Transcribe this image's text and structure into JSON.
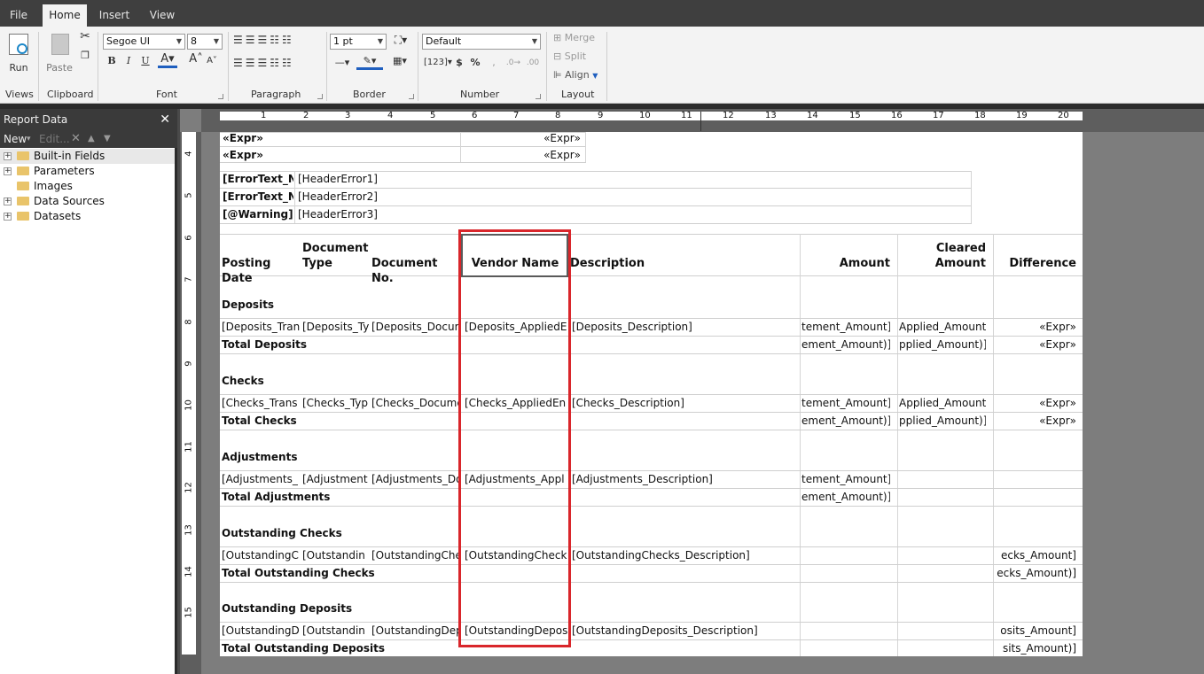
{
  "menu": {
    "tabs": [
      "File",
      "Home",
      "Insert",
      "View"
    ]
  },
  "ribbon": {
    "groups": [
      "Views",
      "Clipboard",
      "Font",
      "Paragraph",
      "Border",
      "Number",
      "Layout"
    ],
    "run_label": "Run",
    "paste_label": "Paste",
    "font_name": "Segoe UI",
    "font_size": "8",
    "border_width": "1 pt",
    "number_format": "Default",
    "merge_label": "Merge",
    "split_label": "Split",
    "align_label": "Align"
  },
  "report_data": {
    "title": "Report Data",
    "new_label": "New",
    "edit_label": "Edit...",
    "items": [
      "Built-in Fields",
      "Parameters",
      "Images",
      "Data Sources",
      "Datasets"
    ]
  },
  "ruler": {
    "top": [
      "1",
      "2",
      "3",
      "4",
      "5",
      "6",
      "7",
      "8",
      "9",
      "10",
      "11",
      "12",
      "13",
      "14",
      "15",
      "16",
      "17",
      "18",
      "19",
      "20"
    ],
    "left": [
      "4",
      "5",
      "6",
      "7",
      "8",
      "9",
      "10",
      "11",
      "12",
      "13",
      "14",
      "15"
    ]
  },
  "report": {
    "expr_rows": [
      {
        "left": "«Expr»",
        "right": "«Expr»"
      },
      {
        "left": "«Expr»",
        "right": "«Expr»"
      }
    ],
    "error_rows": [
      {
        "label": "[ErrorText_Nu",
        "value": "[HeaderError1]"
      },
      {
        "label": "[ErrorText_Nu",
        "value": "[HeaderError2]"
      },
      {
        "label": "[@Warning]",
        "value": "[HeaderError3]"
      }
    ],
    "headers": {
      "posting_date": "Posting Date",
      "document_type": "Document Type",
      "document_no": "Document No.",
      "vendor_name": "Vendor Name",
      "description": "Description",
      "amount": "Amount",
      "cleared_amount": "Cleared Amount",
      "difference": "Difference"
    },
    "sections": [
      {
        "title": "Deposits",
        "row": [
          "[Deposits_Tran",
          "[Deposits_Ty",
          "[Deposits_Docum",
          "[Deposits_AppliedE",
          "[Deposits_Description]",
          "tement_Amount]",
          "Applied_Amount]",
          "«Expr»"
        ],
        "total": [
          "Total Deposits",
          "ement_Amount)]",
          "pplied_Amount)]",
          "«Expr»"
        ]
      },
      {
        "title": "Checks",
        "row": [
          "[Checks_Trans",
          "[Checks_Typ",
          "[Checks_Docume",
          "[Checks_AppliedEn",
          "[Checks_Description]",
          "tement_Amount]",
          "Applied_Amount]",
          "«Expr»"
        ],
        "total": [
          "Total Checks",
          "ement_Amount)]",
          "pplied_Amount)]",
          "«Expr»"
        ]
      },
      {
        "title": "Adjustments",
        "row": [
          "[Adjustments_",
          "[Adjustment",
          "[Adjustments_Do",
          "[Adjustments_Appl",
          "[Adjustments_Description]",
          "tement_Amount]",
          "",
          ""
        ],
        "total": [
          "Total Adjustments",
          "ement_Amount)]",
          "",
          ""
        ]
      },
      {
        "title": "Outstanding Checks",
        "row": [
          "[OutstandingC",
          "[Outstandin",
          "[OutstandingChe",
          "[OutstandingCheck",
          "[OutstandingChecks_Description]",
          "",
          "",
          "ecks_Amount]"
        ],
        "total": [
          "Total Outstanding Checks",
          "",
          "",
          "ecks_Amount)]"
        ]
      },
      {
        "title": "Outstanding Deposits",
        "row": [
          "[OutstandingD",
          "[Outstandin",
          "[OutstandingDep",
          "[OutstandingDepos",
          "[OutstandingDeposits_Description]",
          "",
          "",
          "osits_Amount]"
        ],
        "total": [
          "Total Outstanding Deposits",
          "",
          "",
          "sits_Amount)]"
        ]
      }
    ]
  }
}
